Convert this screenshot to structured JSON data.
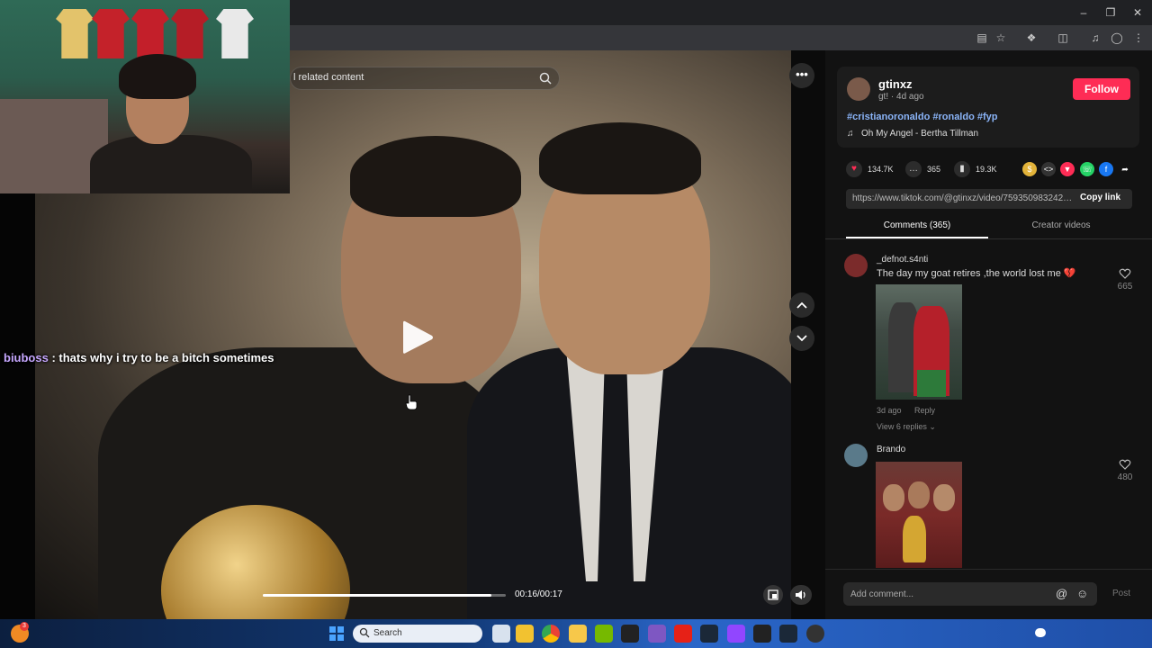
{
  "video": {
    "search_placeholder": "l related content",
    "chat_username": "biuboss",
    "chat_message": " : thats why i try to be a bitch sometimes",
    "time": "00:16/00:17",
    "progress_fraction": 0.94
  },
  "creator": {
    "name": "gtinxz",
    "meta": "gt! · 4d ago",
    "follow_label": "Follow",
    "hashtags": "#cristianoronaldo #ronaldo #fyp",
    "music": "Oh My Angel - Bertha Tillman"
  },
  "stats": {
    "likes": "134.7K",
    "comments": "365",
    "saves": "19.3K"
  },
  "link": {
    "url": "https://www.tiktok.com/@gtinxz/video/7593509832427...",
    "copy_label": "Copy link"
  },
  "tabs": {
    "comments": "Comments (365)",
    "creator_videos": "Creator videos"
  },
  "comments": [
    {
      "username": "_defnot.s4nti",
      "text": "The day my goat retires ,the world lost me",
      "emoji": "💔",
      "age": "3d ago",
      "reply_label": "Reply",
      "view_replies": "View 6 replies",
      "likes": "665"
    },
    {
      "username": "Brando",
      "likes": "480"
    }
  ],
  "footer": {
    "input_placeholder": "Add comment...",
    "post_label": "Post"
  },
  "taskbar": {
    "search_label": "Search",
    "notification_count": "3"
  },
  "colors": {
    "accent": "#fe2c55",
    "hashtag": "#8ab4f8",
    "chat_user": "#c6a7ff"
  }
}
